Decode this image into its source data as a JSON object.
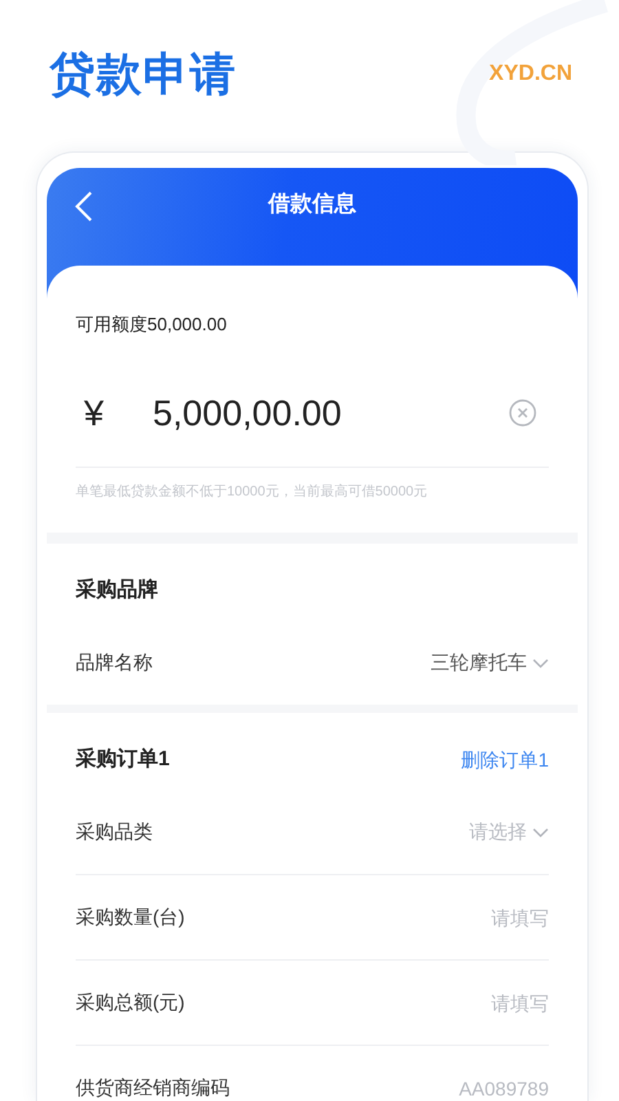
{
  "header": {
    "title": "贷款申请",
    "logo": "XYD.CN"
  },
  "card": {
    "nav_title": "借款信息",
    "amount": {
      "available": "可用额度50,000.00",
      "currency": "¥",
      "value": "5,000,00.00",
      "hint": "单笔最低贷款金额不低于10000元，当前最高可借50000元"
    },
    "sections": [
      {
        "title": "采购品牌",
        "fields": [
          {
            "kind": "select",
            "label": "品牌名称",
            "value": "三轮摩托车"
          }
        ]
      },
      {
        "title": "采购订单1",
        "action": "删除订单1",
        "fields": [
          {
            "kind": "select",
            "label": "采购品类",
            "placeholder": "请选择"
          },
          {
            "kind": "input",
            "label": "采购数量(台)",
            "placeholder": "请填写"
          },
          {
            "kind": "input",
            "label": "采购总额(元)",
            "placeholder": "请填写"
          },
          {
            "kind": "input",
            "label": "供货商经销商编码",
            "placeholder": "AA089789"
          }
        ]
      }
    ]
  }
}
